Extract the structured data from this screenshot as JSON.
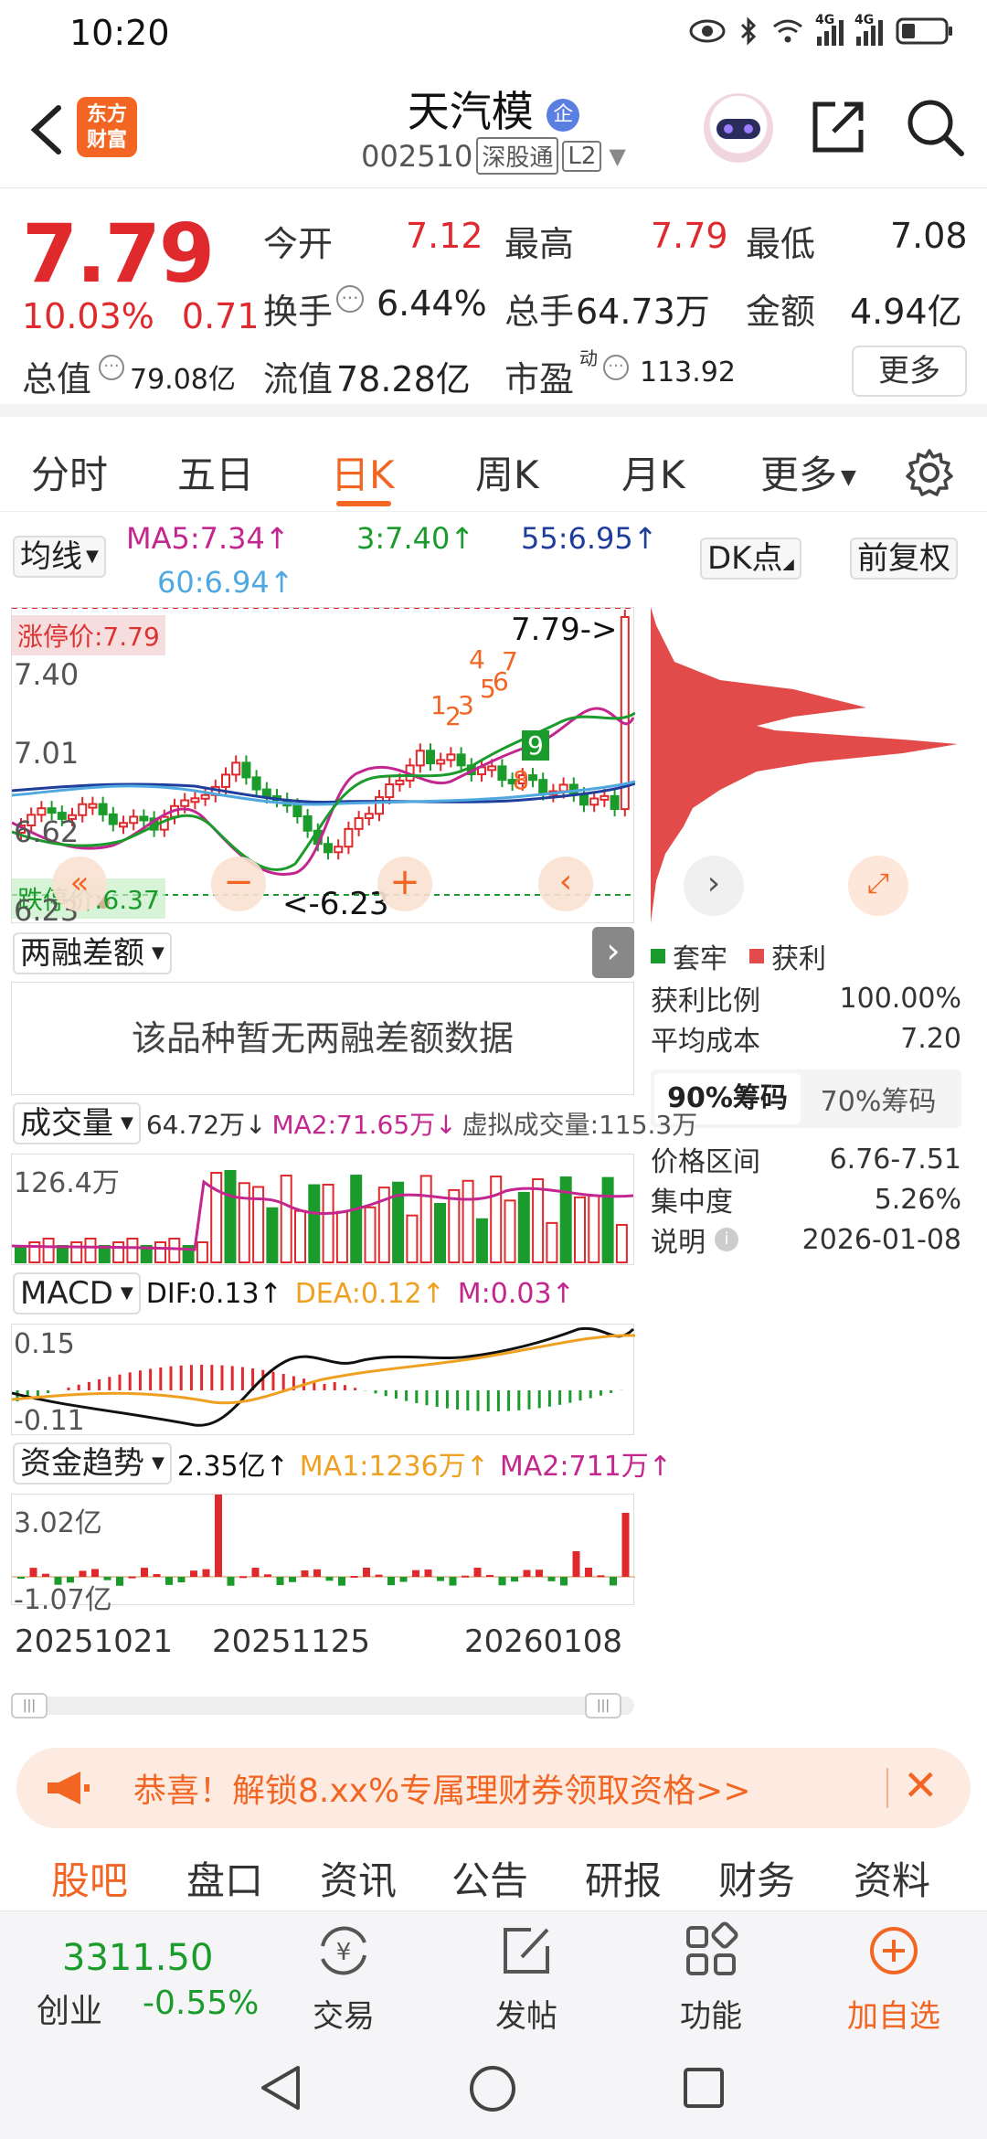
{
  "status_bar": {
    "time": "10:20",
    "net1": "4G",
    "net2": "4G"
  },
  "header": {
    "logo_line1": "东方",
    "logo_line2": "财富",
    "stock_name": "天汽模",
    "name_badge": "企",
    "stock_code": "002510",
    "exchange_tag": "深股通",
    "level_tag": "L2"
  },
  "quote": {
    "price": "7.79",
    "change_pct": "10.03%",
    "change_abs": "0.71",
    "open_label": "今开",
    "open_val": "7.12",
    "high_label": "最高",
    "high_val": "7.79",
    "low_label": "最低",
    "low_val": "7.08",
    "turnover_label": "换手",
    "turnover_val": "6.44%",
    "volume_label": "总手",
    "volume_val": "64.73万",
    "amount_label": "金额",
    "amount_val": "4.94亿",
    "mktcap_label": "总值",
    "mktcap_val": "79.08亿",
    "float_label": "流值",
    "float_val": "78.28亿",
    "pe_label": "市盈",
    "pe_sup": "动",
    "pe_val": "113.92",
    "more_label": "更多"
  },
  "period_tabs": [
    "分时",
    "五日",
    "日K",
    "周K",
    "月K",
    "更多"
  ],
  "ma_row": {
    "ma_btn": "均线",
    "ma5": "MA5:7.34↑",
    "ma3": "3:7.40↑",
    "ma55": "55:6.95↑",
    "ma60": "60:6.94↑",
    "dk_btn": "DK点",
    "adj_btn": "前复权"
  },
  "kline": {
    "limit_up": "涨停价:7.79",
    "limit_down": "跌停价:6.37",
    "y_labels": [
      "7.40",
      "7.01",
      "6.62",
      "6.23"
    ],
    "max_label": "7.79->",
    "min_label": "<-6.23",
    "signal_nums": [
      "1",
      "2",
      "3",
      "4",
      "5",
      "6",
      "7",
      "8",
      "9"
    ]
  },
  "margin": {
    "selector": "两融差额",
    "empty_text": "该品种暂无两融差额数据"
  },
  "chips": {
    "legend_trapped": "套牢",
    "legend_profit": "获利",
    "rows": [
      {
        "label": "获利比例",
        "value": "100.00%"
      },
      {
        "label": "平均成本",
        "value": "7.20"
      }
    ],
    "tab_90": "90%筹码",
    "tab_70": "70%筹码",
    "rows2": [
      {
        "label": "价格区间",
        "value": "6.76-7.51"
      },
      {
        "label": "集中度",
        "value": "5.26%"
      },
      {
        "label": "说明",
        "value": "2026-01-08"
      }
    ]
  },
  "volume": {
    "selector": "成交量",
    "v": "64.72万↓",
    "ma2": "MA2:71.65万↓",
    "virtual": "虚拟成交量:115.3万",
    "y_label": "126.4万"
  },
  "macd": {
    "selector": "MACD",
    "dif": "DIF:0.13↑",
    "dea": "DEA:0.12↑",
    "m": "M:0.03↑",
    "y_top": "0.15",
    "y_bottom": "-0.11"
  },
  "fund": {
    "selector": "资金趋势",
    "v": "2.35亿↑",
    "ma1": "MA1:1236万↑",
    "ma2": "MA2:711万↑",
    "y_top": "3.02亿",
    "y_bottom": "-1.07亿"
  },
  "dates": [
    "20251021",
    "20251125",
    "20260108"
  ],
  "promo": {
    "text": "恭喜！解锁8.xx%专属理财券领取资格>>"
  },
  "content_tabs": [
    "股吧",
    "盘口",
    "资讯",
    "公告",
    "研报",
    "财务",
    "资料"
  ],
  "bottom_nav": {
    "index_value": "3311.50",
    "index_name": "创业",
    "index_change": "-0.55%",
    "items": [
      "交易",
      "发帖",
      "功能",
      "加自选"
    ]
  },
  "colors": {
    "up": "#e0292c",
    "down": "#1a9b2b",
    "accent": "#f26522"
  }
}
